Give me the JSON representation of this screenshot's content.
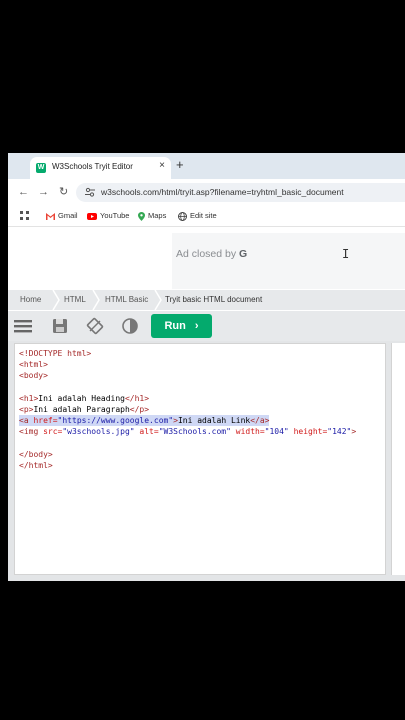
{
  "browser": {
    "tab": {
      "title": "W3Schools Tryit Editor",
      "favicon": "W",
      "close": "×"
    },
    "new_tab": "+",
    "nav": {
      "back": "←",
      "forward": "→",
      "reload": "↻"
    },
    "url": "w3schools.com/html/tryit.asp?filename=tryhtml_basic_document",
    "bookmarks": [
      {
        "label": "Gmail",
        "icon": "gmail-icon"
      },
      {
        "label": "YouTube",
        "icon": "youtube-icon"
      },
      {
        "label": "Maps",
        "icon": "maps-icon"
      },
      {
        "label": "Edit site",
        "icon": "globe-icon"
      }
    ]
  },
  "ad": {
    "text": "Ad closed by ",
    "brand": "G"
  },
  "breadcrumb": [
    "Home",
    "HTML",
    "HTML Basic",
    "Tryit basic HTML document"
  ],
  "toolbar": {
    "run_label": "Run",
    "run_icon": "›"
  },
  "colors": {
    "accent": "#04aa6d",
    "tag": "#a52a2a",
    "attr": "#d11a1a",
    "value": "#1a1aa6",
    "highlight": "#cfd8f5"
  },
  "editor": {
    "lines": [
      [
        {
          "t": "<!DOCTYPE html>",
          "c": "tag"
        }
      ],
      [
        {
          "t": "<html>",
          "c": "tag"
        }
      ],
      [
        {
          "t": "<body>",
          "c": "tag"
        }
      ],
      [],
      [
        {
          "t": "<h1>",
          "c": "tag"
        },
        {
          "t": "Ini adalah Heading",
          "c": ""
        },
        {
          "t": "</h1>",
          "c": "tag"
        }
      ],
      [
        {
          "t": "<p>",
          "c": "tag"
        },
        {
          "t": "Ini adalah Paragraph",
          "c": ""
        },
        {
          "t": "</p>",
          "c": "tag"
        }
      ],
      [
        {
          "t": "<a ",
          "c": "tag"
        },
        {
          "t": "href=",
          "c": "attr"
        },
        {
          "t": "\"https://www.google.com\"",
          "c": "val"
        },
        {
          "t": ">",
          "c": "tag"
        },
        {
          "t": "Ini adalah Link",
          "c": ""
        },
        {
          "t": "</a>",
          "c": "tag"
        }
      ],
      [
        {
          "t": "<img ",
          "c": "tag"
        },
        {
          "t": "src=",
          "c": "attr"
        },
        {
          "t": "\"w3schools.jpg\" ",
          "c": "val"
        },
        {
          "t": "alt=",
          "c": "attr"
        },
        {
          "t": "\"W3Schools.com\" ",
          "c": "val"
        },
        {
          "t": "width=",
          "c": "attr"
        },
        {
          "t": "\"104\" ",
          "c": "val"
        },
        {
          "t": "height=",
          "c": "attr"
        },
        {
          "t": "\"142\"",
          "c": "val"
        },
        {
          "t": ">",
          "c": "tag"
        }
      ],
      [],
      [
        {
          "t": "</body>",
          "c": "tag"
        }
      ],
      [
        {
          "t": "</html>",
          "c": "tag"
        }
      ]
    ],
    "highlighted_line": 7
  }
}
